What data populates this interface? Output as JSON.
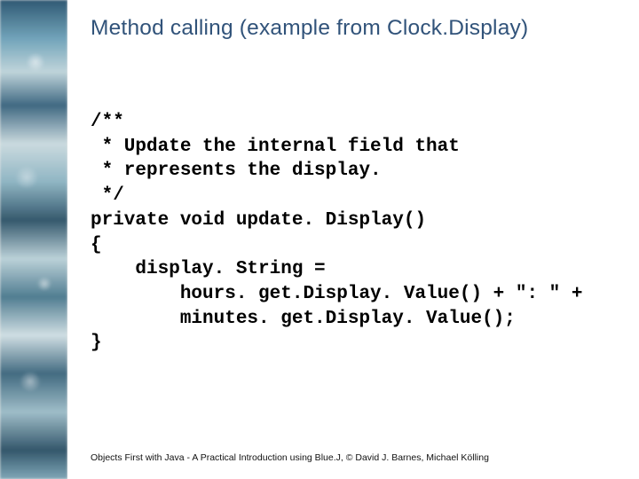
{
  "title": "Method calling (example from Clock.Display)",
  "code_lines": [
    "/**",
    " * Update the internal field that",
    " * represents the display.",
    " */",
    "private void update. Display()",
    "{",
    "    display. String =",
    "        hours. get.Display. Value() + \": \" +",
    "        minutes. get.Display. Value();",
    "}"
  ],
  "footer": "Objects First with Java - A  Practical Introduction using Blue.J, © David J. Barnes, Michael Kölling"
}
